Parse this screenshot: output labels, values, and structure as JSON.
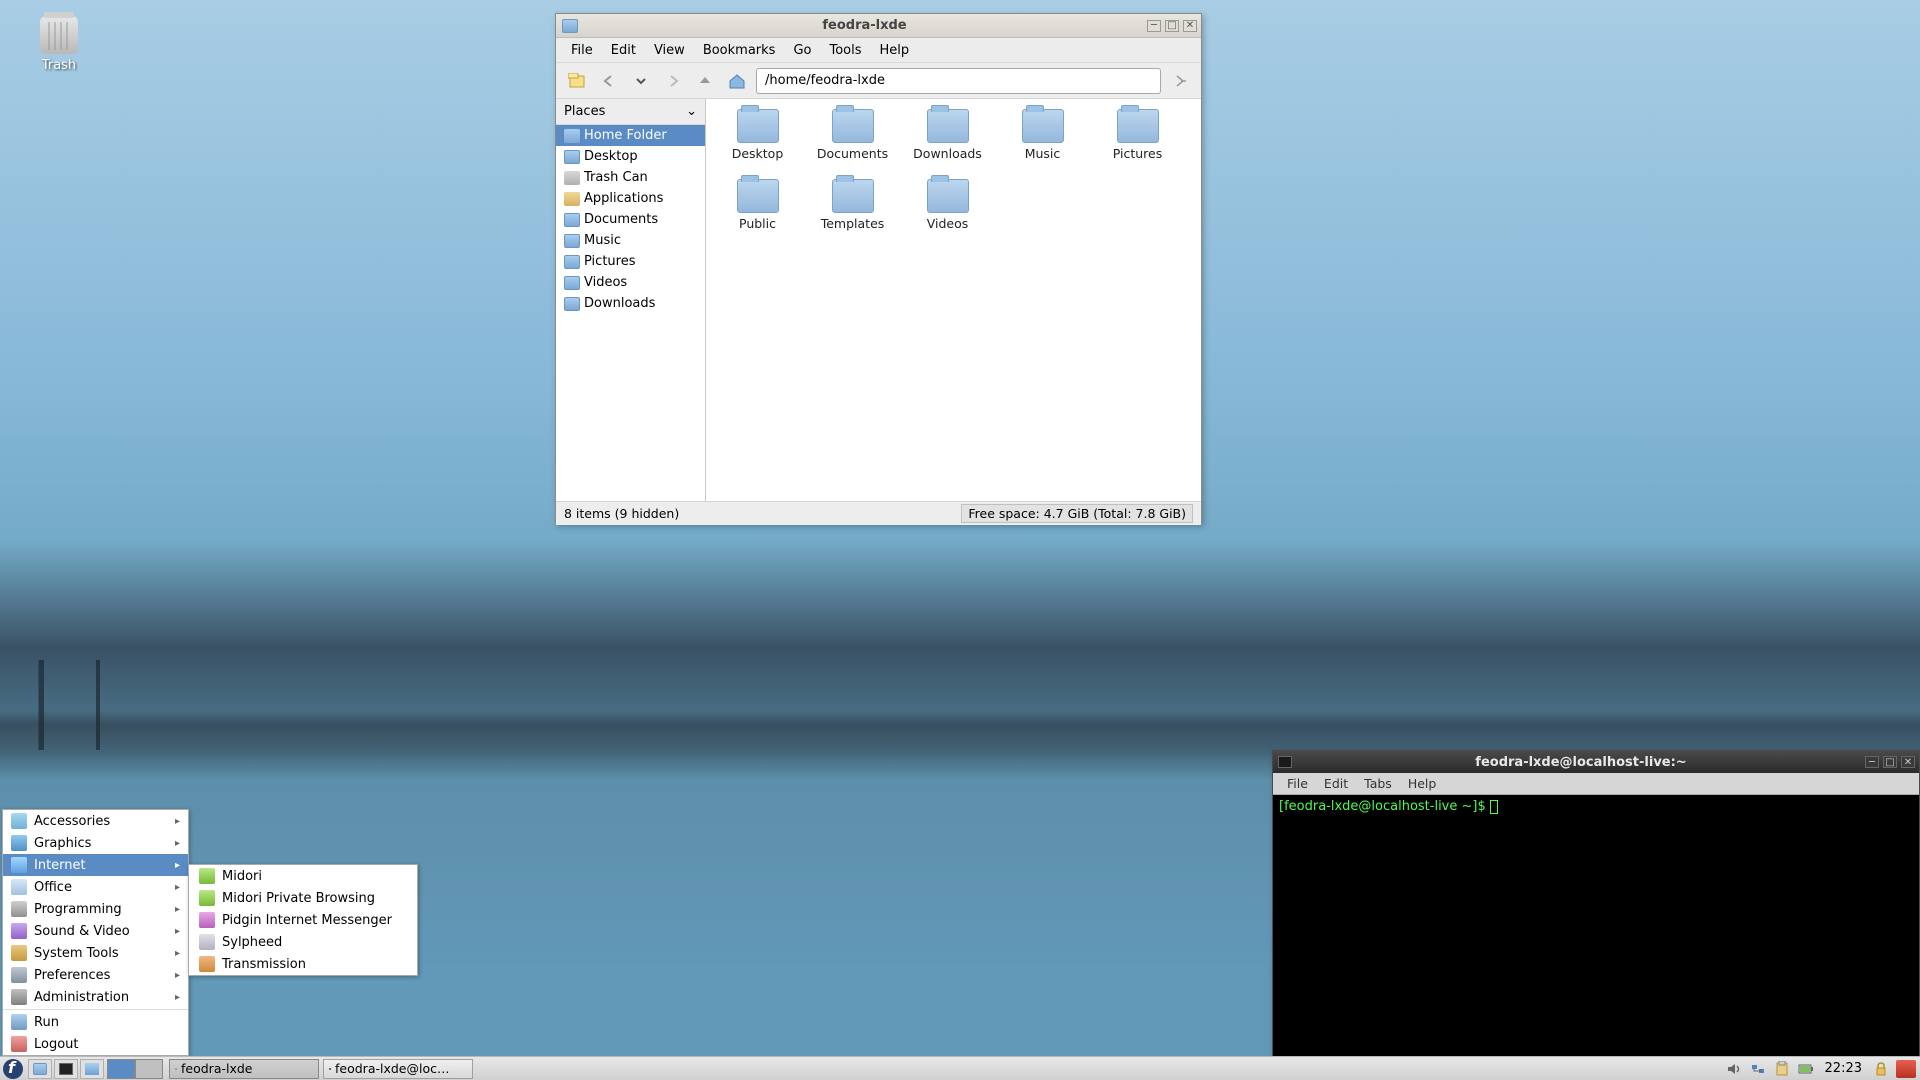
{
  "desktop": {
    "trash_label": "Trash"
  },
  "fm": {
    "title": "feodra-lxde",
    "menu": [
      "File",
      "Edit",
      "View",
      "Bookmarks",
      "Go",
      "Tools",
      "Help"
    ],
    "address": "/home/feodra-lxde",
    "sidebar_title": "Places",
    "sidebar": [
      {
        "label": "Home Folder",
        "icon": "home",
        "active": true
      },
      {
        "label": "Desktop",
        "icon": "folder"
      },
      {
        "label": "Trash Can",
        "icon": "trash"
      },
      {
        "label": "Applications",
        "icon": "app"
      },
      {
        "label": "Documents",
        "icon": "folder"
      },
      {
        "label": "Music",
        "icon": "folder"
      },
      {
        "label": "Pictures",
        "icon": "folder"
      },
      {
        "label": "Videos",
        "icon": "folder"
      },
      {
        "label": "Downloads",
        "icon": "folder"
      }
    ],
    "folders": [
      "Desktop",
      "Documents",
      "Downloads",
      "Music",
      "Pictures",
      "Public",
      "Templates",
      "Videos"
    ],
    "status_left": "8 items (9 hidden)",
    "status_right": "Free space: 4.7 GiB (Total: 7.8 GiB)"
  },
  "term": {
    "title": "feodra-lxde@localhost-live:~",
    "menu": [
      "File",
      "Edit",
      "Tabs",
      "Help"
    ],
    "prompt": "[feodra-lxde@localhost-live ~]$ "
  },
  "appmenu": {
    "items": [
      {
        "label": "Accessories",
        "icon": "mi-acc",
        "arrow": true
      },
      {
        "label": "Graphics",
        "icon": "mi-gfx",
        "arrow": true
      },
      {
        "label": "Internet",
        "icon": "mi-net",
        "arrow": true,
        "hover": true
      },
      {
        "label": "Office",
        "icon": "mi-off",
        "arrow": true
      },
      {
        "label": "Programming",
        "icon": "mi-prog",
        "arrow": true
      },
      {
        "label": "Sound & Video",
        "icon": "mi-snd",
        "arrow": true
      },
      {
        "label": "System Tools",
        "icon": "mi-sys",
        "arrow": true
      },
      {
        "label": "Preferences",
        "icon": "mi-pref",
        "arrow": true
      },
      {
        "label": "Administration",
        "icon": "mi-admin",
        "arrow": true
      }
    ],
    "bottom": [
      {
        "label": "Run",
        "icon": "mi-run"
      },
      {
        "label": "Logout",
        "icon": "mi-logout"
      }
    ],
    "submenu": [
      {
        "label": "Midori",
        "icon": "mi-midori"
      },
      {
        "label": "Midori Private Browsing",
        "icon": "mi-midori"
      },
      {
        "label": "Pidgin Internet Messenger",
        "icon": "mi-pidgin"
      },
      {
        "label": "Sylpheed",
        "icon": "mi-sylph"
      },
      {
        "label": "Transmission",
        "icon": "mi-trans"
      }
    ]
  },
  "taskbar": {
    "tasks": [
      {
        "label": "feodra-lxde",
        "icon": "folder",
        "active": true
      },
      {
        "label": "feodra-lxde@loc…",
        "icon": "term"
      }
    ],
    "clock": "22:23"
  }
}
